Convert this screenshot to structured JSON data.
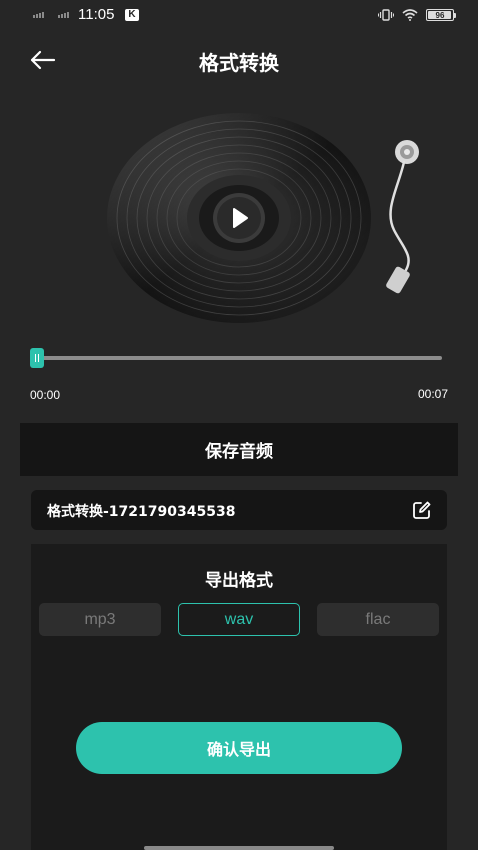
{
  "status_bar": {
    "time": "11:05",
    "notification_icon": "k-icon",
    "battery_level": "96",
    "icons": [
      "signal-icon",
      "signal-icon",
      "vibrate-icon",
      "wifi-icon",
      "battery-icon"
    ]
  },
  "header": {
    "title": "格式转换",
    "back_icon": "arrow-left-icon"
  },
  "player": {
    "play_icon": "play-icon",
    "current_time": "00:00",
    "total_time": "00:07",
    "progress": 0
  },
  "save_section": {
    "label": "保存音频"
  },
  "file": {
    "name": "格式转换-1721790345538",
    "edit_icon": "edit-icon"
  },
  "export": {
    "title": "导出格式",
    "formats": [
      "mp3",
      "wav",
      "flac"
    ],
    "selected": "wav",
    "confirm_label": "确认导出"
  },
  "colors": {
    "accent": "#2dc2ad",
    "background": "#262626",
    "panel": "#1b1b1b",
    "bar": "#151515"
  }
}
